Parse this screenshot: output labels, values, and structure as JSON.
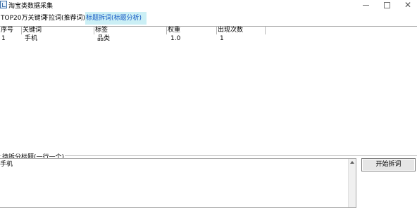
{
  "window": {
    "title": "淘宝类数据采集",
    "controls": {
      "minimize": "minimize",
      "maximize": "maximize",
      "close": "✕"
    }
  },
  "tabs": [
    {
      "label": "TOP20万关键词",
      "active": false
    },
    {
      "label": "下拉词(推荐词)",
      "active": false
    },
    {
      "label": "标题拆词(标题分析)",
      "active": true
    }
  ],
  "table": {
    "columns": [
      "序号",
      "关键词",
      "标签",
      "权重",
      "出现次数"
    ],
    "rows": [
      [
        "1",
        "手机",
        "品类",
        "1.0",
        "1"
      ]
    ]
  },
  "split_group": {
    "label": "待拆分标题(一行一个)",
    "text": "手机"
  },
  "start_button": {
    "label": "开始拆词"
  },
  "colors": {
    "active_tab_bg": "#cbeff5",
    "active_tab_text": "#1256c4"
  }
}
